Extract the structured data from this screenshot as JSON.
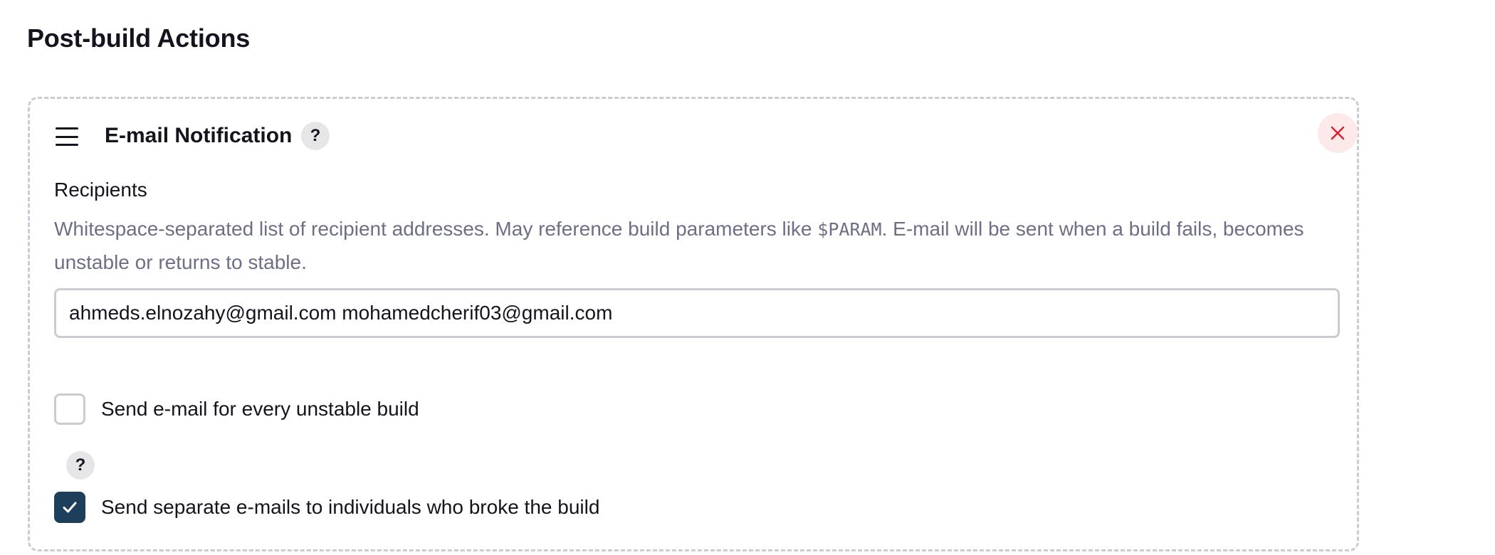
{
  "section": {
    "title": "Post-build Actions"
  },
  "email_notification": {
    "title": "E-mail Notification",
    "help_label": "?",
    "delete_icon": "close-icon",
    "drag_icon": "drag-handle-icon",
    "recipients": {
      "label": "Recipients",
      "description_before": "Whitespace-separated list of recipient addresses. May reference build parameters like ",
      "description_code": "$PARAM",
      "description_after": ". E-mail will be sent when a build fails, becomes unstable or returns to stable.",
      "value": "ahmeds.elnozahy@gmail.com mohamedcherif03@gmail.com"
    },
    "unstable_checkbox": {
      "label": "Send e-mail for every unstable build",
      "checked": false
    },
    "separate_checkbox": {
      "help_label": "?",
      "label": "Send separate e-mails to individuals who broke the build",
      "checked": true
    }
  },
  "colors": {
    "accent": "#1e3f5c",
    "delete_bg": "#fde9ea",
    "delete_icon": "#d9202c",
    "muted_text": "#6d6f86",
    "border": "#c9ccd3"
  }
}
